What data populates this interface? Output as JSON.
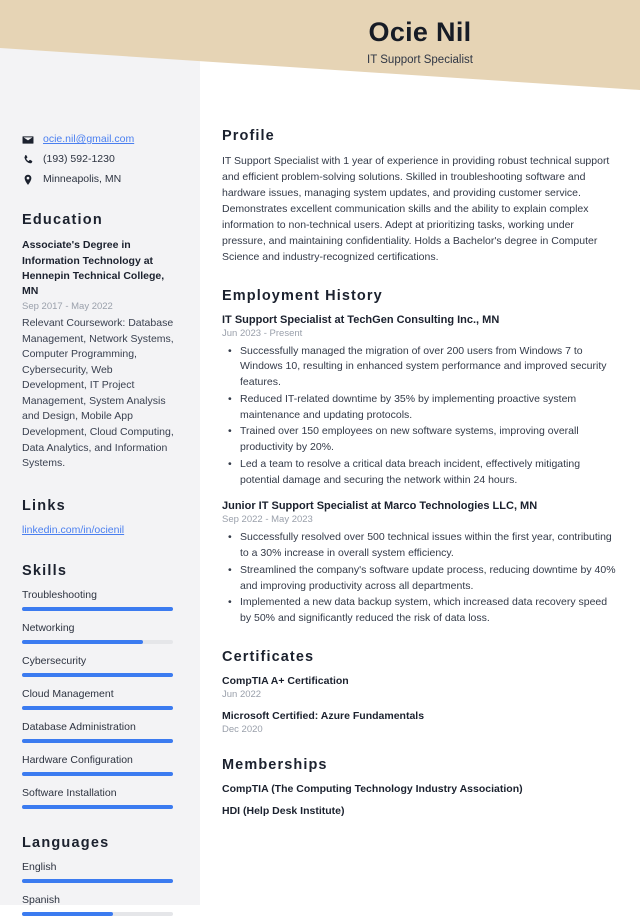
{
  "header": {
    "name": "Ocie Nil",
    "job_title": "IT Support Specialist",
    "background_color": "#e6d4b5"
  },
  "sidebar": {
    "background_color": "#f3f3f5",
    "contact": [
      {
        "icon": "envelope-icon",
        "value": "ocie.nil@gmail.com",
        "is_link": true
      },
      {
        "icon": "phone-icon",
        "value": "(193) 592-1230",
        "is_link": false
      },
      {
        "icon": "location-pin-icon",
        "value": "Minneapolis, MN",
        "is_link": false
      }
    ],
    "education": {
      "heading": "Education",
      "degree": "Associate's Degree in Information Technology at Hennepin Technical College, MN",
      "date": "Sep 2017 - May 2022",
      "description": "Relevant Coursework: Database Management, Network Systems, Computer Programming, Cybersecurity, Web Development, IT Project Management, System Analysis and Design, Mobile App Development, Cloud Computing, Data Analytics, and Information Systems."
    },
    "links": {
      "heading": "Links",
      "items": [
        {
          "label": "linkedin.com/in/ocienil"
        }
      ]
    },
    "skills": {
      "heading": "Skills",
      "accent_color": "#3b7bf0",
      "track_color": "#e5e6e9",
      "items": [
        {
          "label": "Troubleshooting",
          "level": 100
        },
        {
          "label": "Networking",
          "level": 80
        },
        {
          "label": "Cybersecurity",
          "level": 100
        },
        {
          "label": "Cloud Management",
          "level": 100
        },
        {
          "label": "Database Administration",
          "level": 100
        },
        {
          "label": "Hardware Configuration",
          "level": 100
        },
        {
          "label": "Software Installation",
          "level": 100
        }
      ]
    },
    "languages": {
      "heading": "Languages",
      "items": [
        {
          "label": "English",
          "level": 100
        },
        {
          "label": "Spanish",
          "level": 60
        }
      ]
    }
  },
  "main": {
    "profile": {
      "heading": "Profile",
      "text": "IT Support Specialist with 1 year of experience in providing robust technical support and efficient problem-solving solutions. Skilled in troubleshooting software and hardware issues, managing system updates, and providing customer service. Demonstrates excellent communication skills and the ability to explain complex information to non-technical users. Adept at prioritizing tasks, working under pressure, and maintaining confidentiality. Holds a Bachelor's degree in Computer Science and industry-recognized certifications."
    },
    "employment": {
      "heading": "Employment History",
      "jobs": [
        {
          "role": "IT Support Specialist at TechGen Consulting Inc., MN",
          "date": "Jun 2023 - Present",
          "bullets": [
            "Successfully managed the migration of over 200 users from Windows 7 to Windows 10, resulting in enhanced system performance and improved security features.",
            "Reduced IT-related downtime by 35% by implementing proactive system maintenance and updating protocols.",
            "Trained over 150 employees on new software systems, improving overall productivity by 20%.",
            "Led a team to resolve a critical data breach incident, effectively mitigating potential damage and securing the network within 24 hours."
          ]
        },
        {
          "role": "Junior IT Support Specialist at Marco Technologies LLC, MN",
          "date": "Sep 2022 - May 2023",
          "bullets": [
            "Successfully resolved over 500 technical issues within the first year, contributing to a 30% increase in overall system efficiency.",
            "Streamlined the company's software update process, reducing downtime by 40% and improving productivity across all departments.",
            "Implemented a new data backup system, which increased data recovery speed by 50% and significantly reduced the risk of data loss."
          ]
        }
      ]
    },
    "certificates": {
      "heading": "Certificates",
      "items": [
        {
          "name": "CompTIA A+ Certification",
          "date": "Jun 2022"
        },
        {
          "name": "Microsoft Certified: Azure Fundamentals",
          "date": "Dec 2020"
        }
      ]
    },
    "memberships": {
      "heading": "Memberships",
      "items": [
        {
          "name": "CompTIA (The Computing Technology Industry Association)"
        },
        {
          "name": "HDI (Help Desk Institute)"
        }
      ]
    }
  }
}
